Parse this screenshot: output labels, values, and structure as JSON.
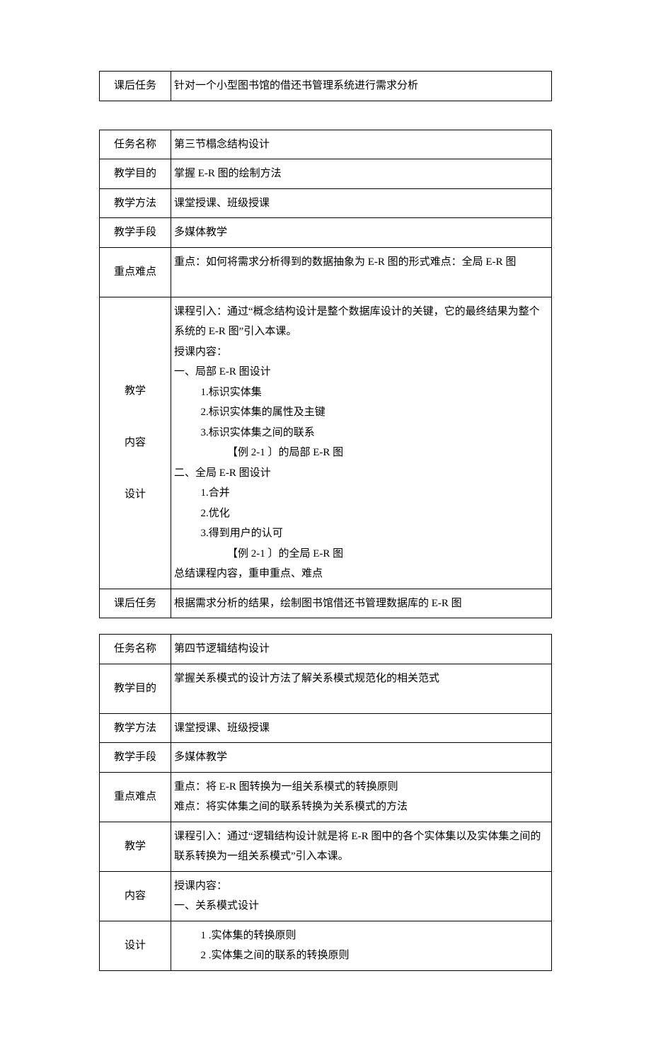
{
  "table1": {
    "row1_label": "课后任务",
    "row1_value": "针对一个小型图书馆的借还书管理系统进行需求分析"
  },
  "table2": {
    "r1_label": "任务名称",
    "r1_value": "第三节榻念结构设计",
    "r2_label": "教学目的",
    "r2_value": "掌握 E-R 图的绘制方法",
    "r3_label": "教学方法",
    "r3_value": "课堂授课、班级授课",
    "r4_label": "教学手段",
    "r4_value": "多媒体教学",
    "r5_label": "重点难点",
    "r5_value": "重点：如何将需求分析得到的数据抽象为 E-R 图的形式难点：全局 E-R 图",
    "r6_label_1": "教学",
    "r6_label_2": "内容",
    "r6_label_3": "设计",
    "r6_line1": "课程引入：通过“概念结构设计是整个数据库设计的关键，它的最终结果为整个系统的 E-R 图”引入本课。",
    "r6_line2": "授课内容：",
    "r6_line3": "一、局部 E-R 图设计",
    "r6_line4": "1.标识实体集",
    "r6_line5": "2.标识实体集的属性及主键",
    "r6_line6": "3.标识实体集之间的联系",
    "r6_line7": "【例 2-1 〕的局部 E-R 图",
    "r6_line8": "二、全局 E-R 图设计",
    "r6_line9": "1.合并",
    "r6_line10": "2.优化",
    "r6_line11": "3.得到用户的认可",
    "r6_line12": "【例 2-1 〕的全局 E-R 图",
    "r6_line13": "总结课程内容，重申重点、难点",
    "r7_label": "课后任务",
    "r7_value": "根据需求分析的结果，绘制图书馆借还书管理数据库的 E-R 图"
  },
  "table3": {
    "r1_label": "任务名称",
    "r1_value": "第四节逻辑结构设计",
    "r2_label": "教学目的",
    "r2_value": "掌握关系模式的设计方法了解关系模式规范化的相关范式",
    "r3_label": "教学方法",
    "r3_value": "课堂授课、班级授课",
    "r4_label": "教学手段",
    "r4_value": "多媒体教学",
    "r5_label": "重点难点",
    "r5_line1": "重点：将 E-R 图转换为一组关系模式的转换原则",
    "r5_line2": "难点：将实体集之间的联系转换为关系模式的方法",
    "r6_label_1": "教学",
    "r6_label_2": "内容",
    "r6_label_3": "设计",
    "r6a_line1": "课程引入：通过“逻辑结构设计就是将 E-R 图中的各个实体集以及实体集之间的联系转换为一组关系模式”引入本课。",
    "r6b_line1": "授课内容：",
    "r6b_line2": "一、关系模式设计",
    "r6c_line1": "1 .实体集的转换原则",
    "r6c_line2": "2 .实体集之间的联系的转换原则"
  }
}
